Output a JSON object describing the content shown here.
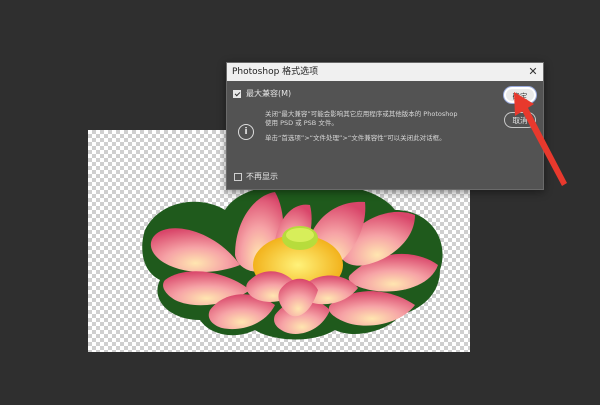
{
  "dialog": {
    "title": "Photoshop 格式选项",
    "close_glyph": "✕",
    "maximize_label": "最大兼容(M)",
    "maximize_checked": true,
    "info_line1": "关闭“最大兼容”可能会影响其它应用程序或其他版本的 Photoshop",
    "info_line2": "使用 PSD 或 PSB 文件。",
    "info_line3": "单击“首选项”>“文件处理”>“文件兼容性”可以关闭此对话框。",
    "dont_show_label": "不再显示",
    "dont_show_checked": false,
    "ok_label": "确定",
    "cancel_label": "取消",
    "info_icon": "info-icon"
  },
  "colors": {
    "app_background": "#2f2f2f",
    "dialog_background": "#535353",
    "annotation_arrow": "#e8392d"
  }
}
